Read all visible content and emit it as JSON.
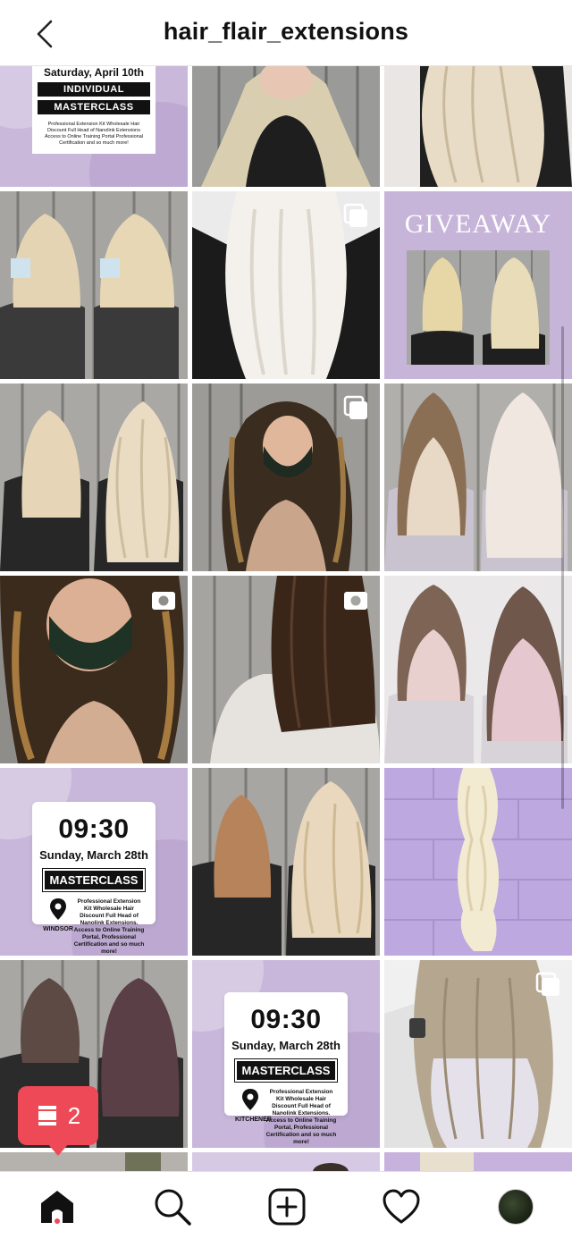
{
  "header": {
    "title": "hair_flair_extensions",
    "back_icon": "chevron-left-icon"
  },
  "posts": {
    "top_card": {
      "date": "Saturday, April 10th",
      "line1": "INDIVIDUAL",
      "line2": "MASTERCLASS",
      "details": "Professional Extension Kit Wholesale Hair Discount Full Head of Nanolink Extensions Access to Online Training Portal Professional Certification and so much more!"
    },
    "giveaway": {
      "title": "GIVEAWAY"
    },
    "windsor_card": {
      "time": "09:30",
      "date": "Sunday, March 28th",
      "tag": "MASTERCLASS",
      "location": "WINDSOR",
      "details": "Professional Extension Kit Wholesale Hair Discount Full Head of Nanolink Extensions. Access to Online Training Portal, Professional Certification and so much more!"
    },
    "kitchener_card": {
      "time": "09:30",
      "date": "Sunday, March 28th",
      "tag": "MASTERCLASS",
      "location": "KITCHENER",
      "details": "Professional Extension Kit Wholesale Hair Discount Full Head of Nanolink Extensions. Access to Online Training Portal, Professional Certification and so much more!"
    }
  },
  "notification": {
    "count": "2",
    "icon": "posts-notification-icon"
  },
  "tabbar": {
    "home_icon": "home-icon",
    "search_icon": "search-icon",
    "add_icon": "add-post-icon",
    "activity_icon": "heart-icon",
    "profile_icon": "profile-avatar"
  },
  "colors": {
    "accent": "#ed4956",
    "lavender": "#c8b6d8",
    "text": "#111111"
  }
}
